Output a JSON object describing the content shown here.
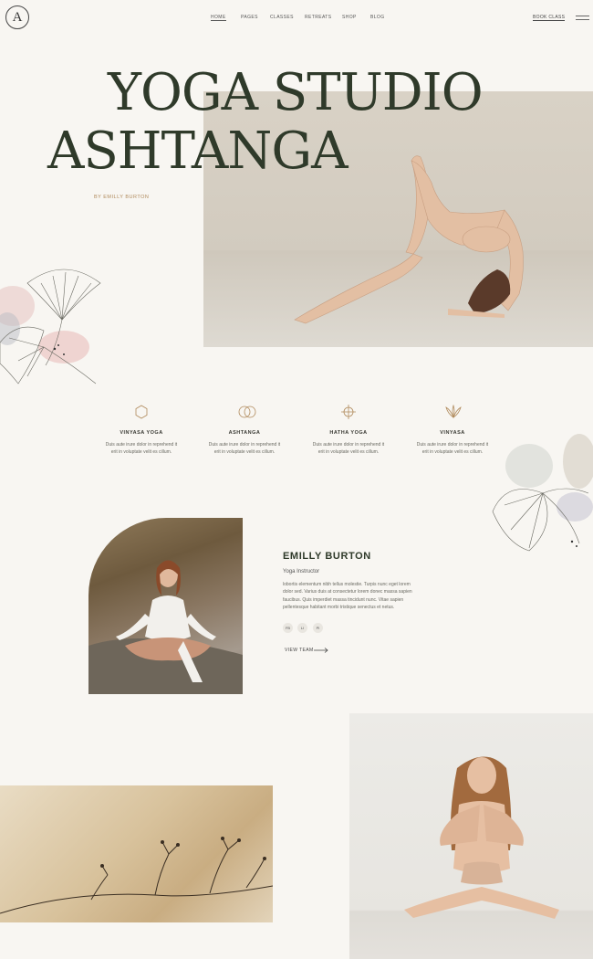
{
  "header": {
    "logo_letter": "A",
    "nav": [
      {
        "label": "HOME",
        "active": true
      },
      {
        "label": "PAGES",
        "active": false
      },
      {
        "label": "CLASSES",
        "active": false
      },
      {
        "label": "RETREATS",
        "active": false
      },
      {
        "label": "SHOP",
        "active": false
      },
      {
        "label": "BLOG",
        "active": false
      }
    ],
    "cta_label": "BOOK CLASS",
    "menu_icon": "hamburger-icon"
  },
  "hero": {
    "title_line1": "YOGA STUDIO",
    "title_line2": "ASHTANGA",
    "byline": "BY EMILLY BURTON"
  },
  "services": [
    {
      "icon": "hexagon-icon",
      "name": "VINYASA YOGA",
      "desc_line1": "Duis aute irure dolor in reprehend it",
      "desc_line2": "erit in voluptate velit es cillum."
    },
    {
      "icon": "interlocking-circles-icon",
      "name": "ASHTANGA",
      "desc_line1": "Duis aute irure dolor in reprehend it",
      "desc_line2": "erit in voluptate velit es cillum."
    },
    {
      "icon": "cross-circle-icon",
      "name": "HATHA YOGA",
      "desc_line1": "Duis aute irure dolor in reprehend it",
      "desc_line2": "erit in voluptate velit es cillum."
    },
    {
      "icon": "lotus-icon",
      "name": "VINYASA",
      "desc_line1": "Duis aute irure dolor in reprehend it",
      "desc_line2": "erit in voluptate velit es cillum."
    }
  ],
  "instructor": {
    "name": "EMILLY BURTON",
    "role": "Yoga Instructor",
    "bio": "lobortis elementum nibh tellus molestie. Turpis nunc eget lorem dolor sed. Varius duis at consectetur lorem donec massa sapien faucibus. Quis imperdiet massa tincidunt nunc. Vitae sapien pellentesque habitant morbi tristique senectus et netus.",
    "socials": [
      "FB",
      "LI",
      "PI"
    ],
    "view_team_label": "VIEW TEAM"
  },
  "colors": {
    "background": "#f8f6f2",
    "title": "#2f3a2a",
    "accent": "#b08a5c"
  }
}
